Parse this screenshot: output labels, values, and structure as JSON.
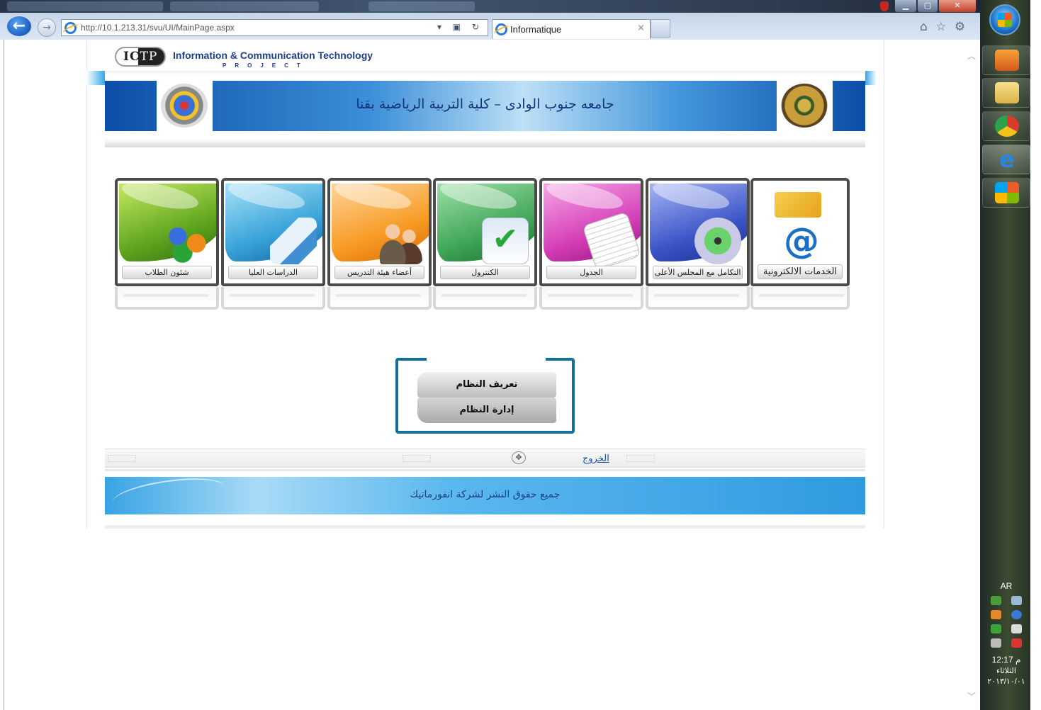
{
  "browser": {
    "url": "http://10.1.213.31/svu/UI/MainPage.aspx",
    "tab_title": "Informatique",
    "tab_close": "×",
    "window_buttons": {
      "minimize": "▁",
      "maximize": "▢",
      "close": "✕"
    }
  },
  "header": {
    "logo_ic": "IC",
    "logo_tp": "TP",
    "org_name": "Information & Communication Technology",
    "org_sub": "PROJECT",
    "banner_title": "جامعه جنوب الوادى – كلية التربية الرياضية بقنا"
  },
  "modules": [
    {
      "id": "students",
      "label": "شئون الطلاب"
    },
    {
      "id": "grad",
      "label": "الدراسات العليا"
    },
    {
      "id": "staff",
      "label": "أعضاء هيئة التدريس"
    },
    {
      "id": "control",
      "label": "الكنترول"
    },
    {
      "id": "schedule",
      "label": "الجدول"
    },
    {
      "id": "council",
      "label": "التكامل مع المجلس الأعلى"
    },
    {
      "id": "eservices",
      "label": "الخدمات الالكترونية"
    }
  ],
  "admin": {
    "about_label": "تعريف النظام",
    "manage_label": "إدارة النظام"
  },
  "footer": {
    "logout": "الخروج",
    "copyright": "جميع حقوق النشر لشركة انفورماتيك"
  },
  "taskbar": {
    "lang": "AR",
    "time": "12:17 م",
    "day": "الثلاثاء",
    "date": "٢٠١٣/١٠/٠١"
  },
  "colors": {
    "banner_blue": "#0d4ea8",
    "accent_teal": "#14709a",
    "link_blue": "#1a4b9e"
  }
}
